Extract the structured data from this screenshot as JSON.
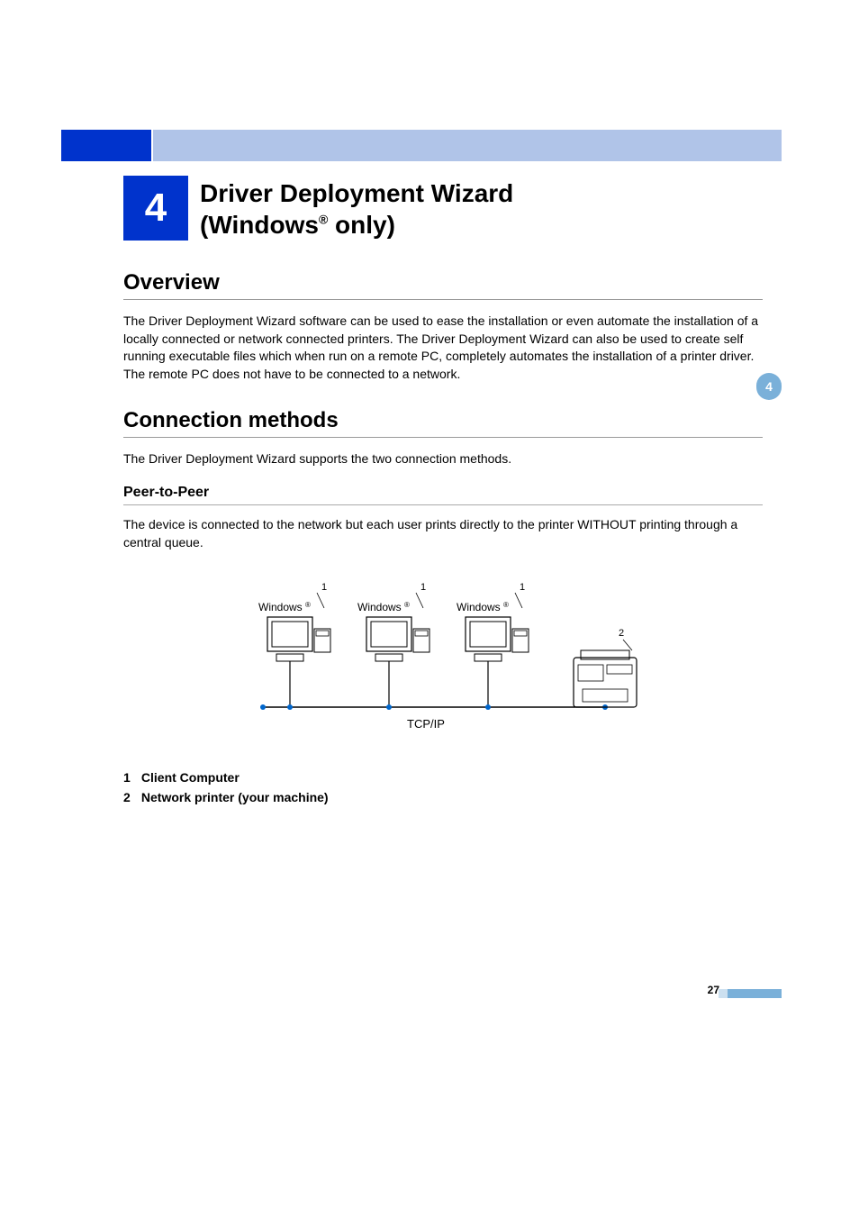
{
  "chapter": {
    "number": "4",
    "title_line1": "Driver Deployment Wizard",
    "title_line2_pre": "(Windows",
    "title_line2_sup": "®",
    "title_line2_post": " only)"
  },
  "sections": {
    "overview": {
      "heading": "Overview",
      "paragraph": "The Driver Deployment Wizard software can be used to ease the installation or even automate the installation of a locally connected or network connected printers. The Driver Deployment Wizard can also be used to create self running executable files which when run on a remote PC, completely automates the installation of a printer driver. The remote PC does not have to be connected to a network."
    },
    "connection_methods": {
      "heading": "Connection methods",
      "intro": "The Driver Deployment Wizard supports the two connection methods.",
      "peer_to_peer": {
        "heading": "Peer-to-Peer",
        "paragraph": "The device is connected to the network but each user prints directly to the printer WITHOUT printing through a central queue."
      }
    }
  },
  "diagram": {
    "computer_label": "Windows",
    "computer_sup": "®",
    "callout_1": "1",
    "callout_2": "2",
    "protocol": "TCP/IP"
  },
  "legend": {
    "items": [
      {
        "num": "1",
        "text": "Client Computer"
      },
      {
        "num": "2",
        "text": "Network printer (your machine)"
      }
    ]
  },
  "side_tab": "4",
  "page_number": "27"
}
